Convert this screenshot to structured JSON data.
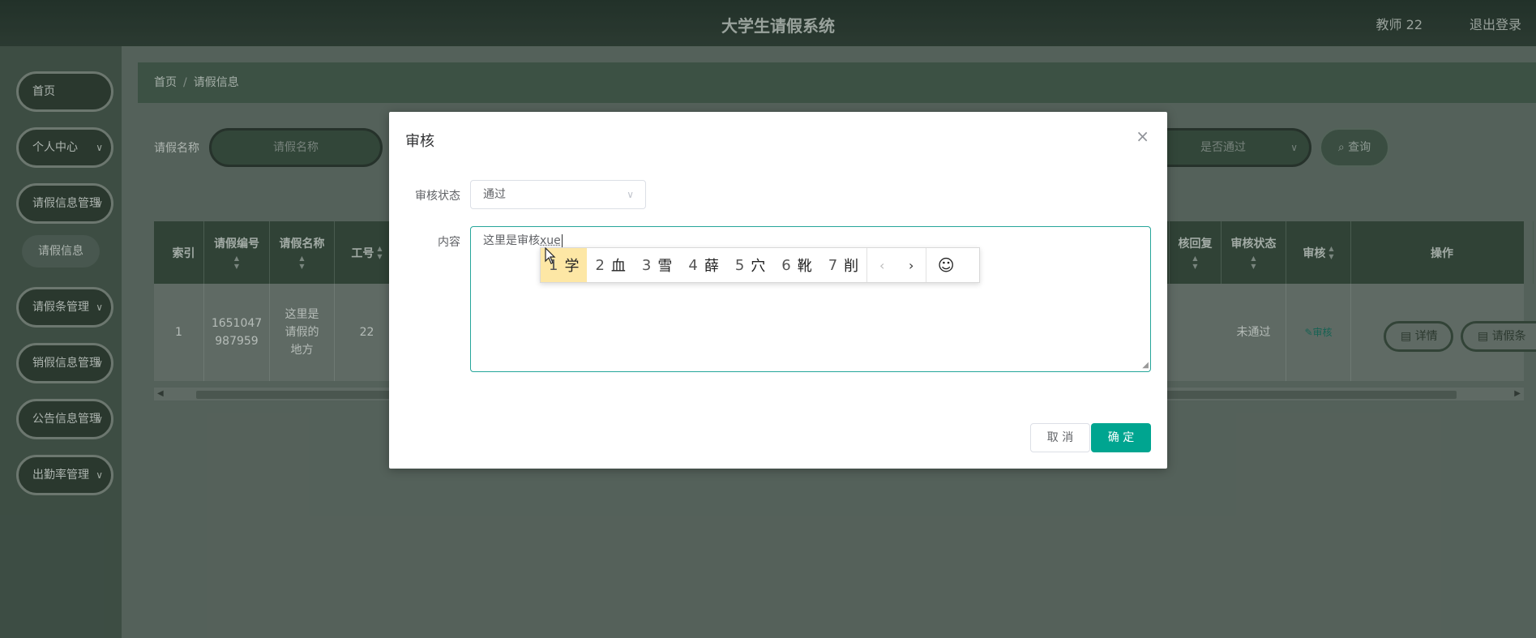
{
  "header": {
    "title": "大学生请假系统",
    "user": "教师 22",
    "logout": "退出登录"
  },
  "sidebar": {
    "items": [
      {
        "label": "首页",
        "has_children": false
      },
      {
        "label": "个人中心",
        "has_children": true
      },
      {
        "label": "请假信息管理",
        "has_children": true
      },
      {
        "label": "请假信息",
        "is_sub": true
      },
      {
        "label": "请假条管理",
        "has_children": true
      },
      {
        "label": "销假信息管理",
        "has_children": true
      },
      {
        "label": "公告信息管理",
        "has_children": true
      },
      {
        "label": "出勤率管理",
        "has_children": true
      }
    ]
  },
  "breadcrumb": {
    "home": "首页",
    "separator": "/",
    "current": "请假信息"
  },
  "search": {
    "name_label": "请假名称",
    "name_placeholder": "请假名称",
    "pass_placeholder": "是否通过",
    "query_label": "查询"
  },
  "table": {
    "headers": [
      "索引",
      "请假编号",
      "请假名称",
      "工号",
      "核回复",
      "审核状态",
      "审核",
      "操作"
    ],
    "row": {
      "index": "1",
      "number": "1651047987959",
      "name": "这里是请假的地方",
      "staff_id": "22",
      "status": "未通过",
      "audit": "审核",
      "actions": [
        "详情",
        "请假条"
      ]
    }
  },
  "dialog": {
    "title": "审核",
    "status_label": "审核状态",
    "status_value": "通过",
    "content_label": "内容",
    "content_value": "这里是审核",
    "content_composing": "xue",
    "cancel": "取 消",
    "confirm": "确 定"
  },
  "ime": {
    "candidates": [
      {
        "num": "1",
        "char": "学"
      },
      {
        "num": "2",
        "char": "血"
      },
      {
        "num": "3",
        "char": "雪"
      },
      {
        "num": "4",
        "char": "薛"
      },
      {
        "num": "5",
        "char": "穴"
      },
      {
        "num": "6",
        "char": "靴"
      },
      {
        "num": "7",
        "char": "削"
      }
    ],
    "active_index": 0
  },
  "colors": {
    "accent": "#00a590",
    "header_bg": "#1a2a22",
    "sidebar_pill": "#253328"
  }
}
